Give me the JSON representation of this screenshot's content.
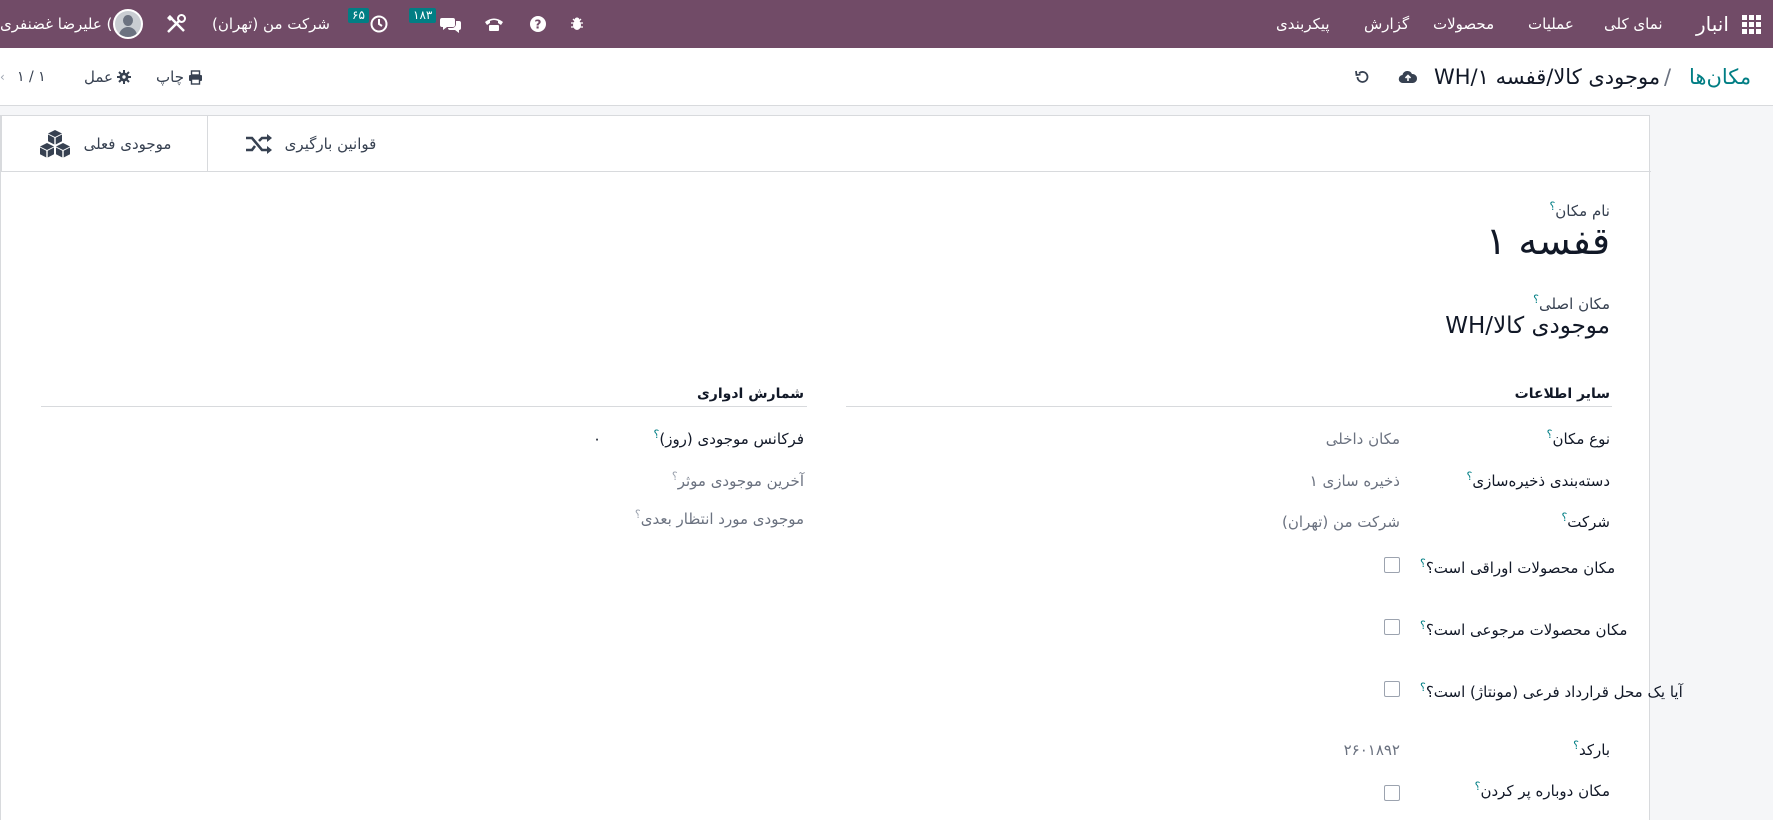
{
  "topbar": {
    "brand": "انبار",
    "menu": [
      "نمای کلی",
      "عملیات",
      "محصولات",
      "گزارش",
      "پیکربندی"
    ],
    "activity_count": "۶۵",
    "messages_count": "۱۸۳",
    "company": "شرکت من (تهران)",
    "user": "علیرضا غضنفری (",
    "bg_color": "#714b67"
  },
  "breadcrumb": {
    "parent": "مکان‌ها",
    "separator": "/",
    "current": "WH/موجودی کالا/قفسه ۱"
  },
  "control": {
    "print": "چاپ",
    "action": "عمل",
    "pager": "۱ / ۱"
  },
  "stat_buttons": {
    "putaway": "قوانین بارگیری",
    "current_stock": "موجودی فعلی"
  },
  "form": {
    "name_label": "نام مکان",
    "name_value": "قفسه ۱",
    "parent_label": "مکان اصلی",
    "parent_value": "WH/موجودی کالا",
    "section_other": "سایر اطلاعات",
    "section_count": "شمارش ادواری",
    "q_mark": "؟",
    "fields": {
      "type_label": "نوع مکان",
      "type_value": "مکان داخلی",
      "storage_label": "دسته‌بندی ذخیره‌سازی",
      "storage_value": "ذخیره سازی ۱",
      "company_label": "شرکت",
      "company_value": "شرکت من (تهران)",
      "scrap_label": "مکان محصولات اوراقی است؟",
      "return_label": "مکان محصولات مرجوعی است؟",
      "subcontract_label": "آیا یک محل قرارداد فرعی (مونتاژ) است؟",
      "barcode_label": "بارکد",
      "barcode_value": "۲۶۰۱۸۹۲",
      "replenish_label": "مکان دوباره پر کردن"
    },
    "count": {
      "frequency_label": "فرکانس موجودی (روز)",
      "frequency_value": "۰",
      "last_label": "آخرین موجودی موثر",
      "next_label": "موجودی مورد انتظار بعدی"
    }
  }
}
